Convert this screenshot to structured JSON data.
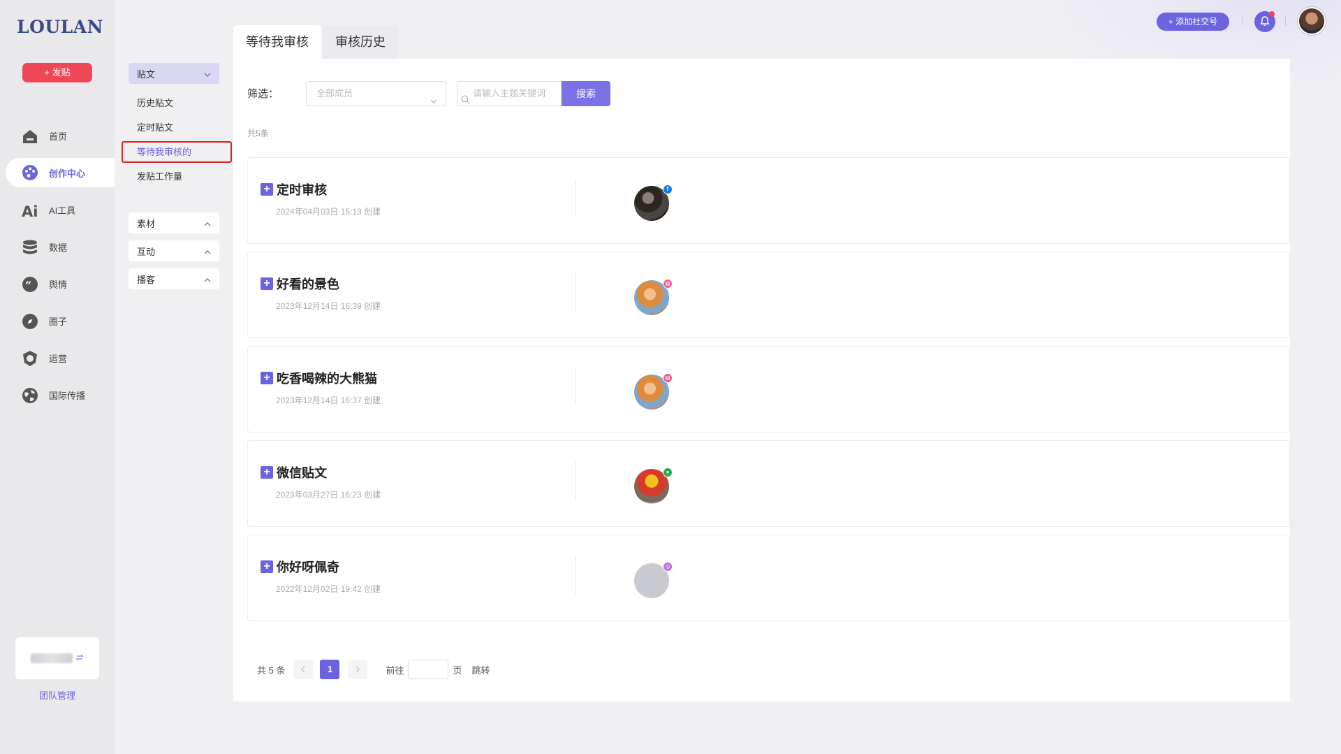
{
  "app": {
    "logo": "LOULAN",
    "post_button": "+ 发贴"
  },
  "nav": [
    {
      "label": "首页",
      "icon": "home-icon"
    },
    {
      "label": "创作中心",
      "icon": "palette-icon",
      "active": true
    },
    {
      "label": "AI工具",
      "icon": "ai-icon"
    },
    {
      "label": "数据",
      "icon": "database-icon"
    },
    {
      "label": "舆情",
      "icon": "quote-icon"
    },
    {
      "label": "圈子",
      "icon": "compass-icon"
    },
    {
      "label": "运营",
      "icon": "shield-icon"
    },
    {
      "label": "国际传播",
      "icon": "globe-icon"
    }
  ],
  "team_link": "团队管理",
  "submenu": {
    "posts": {
      "label": "贴文",
      "items": [
        "历史贴文",
        "定时贴文",
        "等待我审核的",
        "发贴工作量"
      ]
    },
    "groups": [
      "素材",
      "互动",
      "播客"
    ]
  },
  "header": {
    "add_social": "+ 添加社交号"
  },
  "tabs": [
    "等待我审核",
    "审核历史"
  ],
  "filter": {
    "label": "筛选：",
    "member_placeholder": "全部成员",
    "search_placeholder": "请输入主题关键词",
    "search_button": "搜索"
  },
  "total_text": "共5条",
  "items": [
    {
      "title": "定时审核",
      "created": "2024年04月03日 15:13 创建",
      "platform": "facebook",
      "platform_color": "#1877f2"
    },
    {
      "title": "好看的景色",
      "created": "2023年12月14日 16:39 创建",
      "platform": "xiaohongshu",
      "platform_color": "#ef5b8b"
    },
    {
      "title": "吃香喝辣的大熊猫",
      "created": "2023年12月14日 16:37 创建",
      "platform": "xiaohongshu",
      "platform_color": "#ef5b8b"
    },
    {
      "title": "微信贴文",
      "created": "2023年03月27日 16:23 创建",
      "platform": "wechat",
      "platform_color": "#21b04b"
    },
    {
      "title": "你好呀佩奇",
      "created": "2022年12月02日 19:42 创建",
      "platform": "other",
      "platform_color": "#b66ce0"
    }
  ],
  "pagination": {
    "total": "共 5 条",
    "current_page": "1",
    "goto_prefix": "前往",
    "goto_suffix": "页",
    "jump": "跳转"
  },
  "colors": {
    "accent": "#6c63e0",
    "danger": "#ef4755"
  }
}
